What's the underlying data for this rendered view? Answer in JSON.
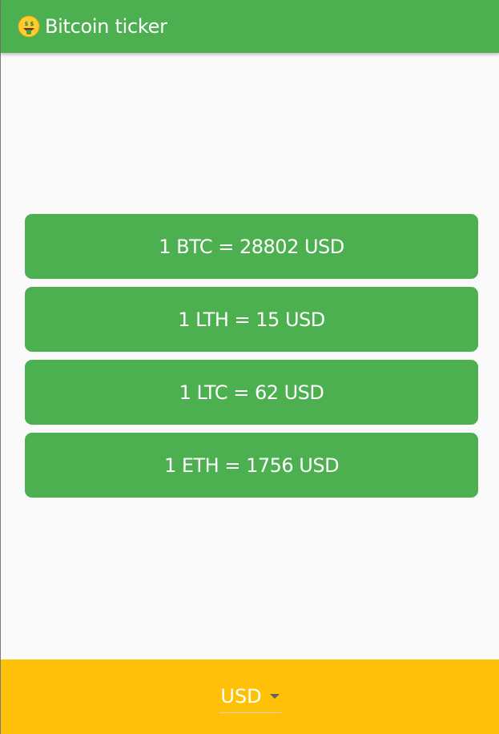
{
  "app": {
    "title": "Bitcoin ticker",
    "icon": "money-mouth-face-emoji",
    "accent_color": "#4caf50",
    "bottom_bar_color": "#ffc107"
  },
  "rates": [
    {
      "label": "1 BTC = 28802 USD"
    },
    {
      "label": "1 LTH = 15 USD"
    },
    {
      "label": "1 LTC = 62 USD"
    },
    {
      "label": "1 ETH = 1756 USD"
    }
  ],
  "currency_selector": {
    "selected": "USD"
  }
}
